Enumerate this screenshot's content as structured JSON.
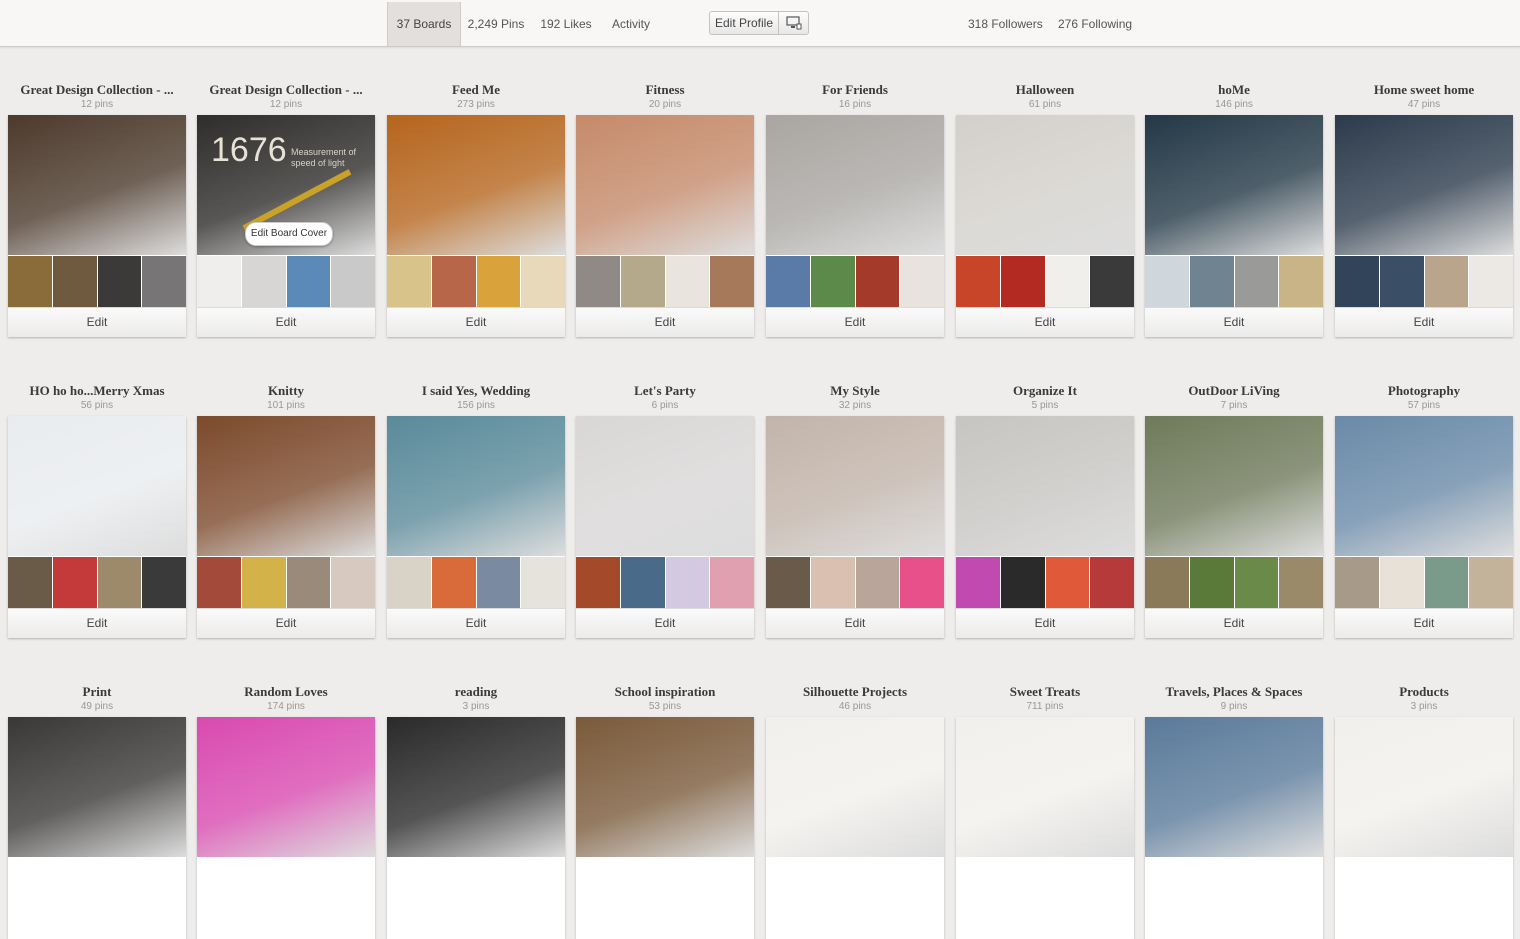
{
  "topbar": {
    "tabs": [
      "37 Boards",
      "2,249 Pins",
      "192 Likes",
      "Activity"
    ],
    "edit_profile": "Edit Profile",
    "followers": "318 Followers",
    "following": "276 Following"
  },
  "edit_label": "Edit",
  "edit_board_cover": "Edit Board Cover",
  "cover_number": "1676",
  "cover_caption": "Measurement of speed of light",
  "boards": [
    {
      "title": "Great Design Collection - ...",
      "count": "12 pins",
      "cover": "#4c3a2c",
      "thumbs": [
        "#8a6b3a",
        "#6f5a3f",
        "#3b3a38",
        "#777575"
      ]
    },
    {
      "title": "Great Design Collection - ...",
      "count": "12 pins",
      "cover": "#2f2d2b",
      "thumbs": [
        "#f0eeec",
        "#d8d6d4",
        "#5c8ab8",
        "#c9c9c9"
      ]
    },
    {
      "title": "Feed Me",
      "count": "273 pins",
      "cover": "#b5651d",
      "thumbs": [
        "#d8c38a",
        "#b7664a",
        "#d9a23a",
        "#e7d9b9"
      ]
    },
    {
      "title": "Fitness",
      "count": "20 pins",
      "cover": "#c58a6a",
      "thumbs": [
        "#8f8a86",
        "#b4a98a",
        "#e9e5de",
        "#a5795a"
      ]
    },
    {
      "title": "For Friends",
      "count": "16 pins",
      "cover": "#a9a6a2",
      "thumbs": [
        "#5a7aa8",
        "#5c8a4a",
        "#a43a2a",
        "#e8e3de"
      ]
    },
    {
      "title": "Halloween",
      "count": "61 pins",
      "cover": "#d3d0cb",
      "thumbs": [
        "#c9452a",
        "#b32a23",
        "#f1efec",
        "#3a3a3a"
      ]
    },
    {
      "title": "hoMe",
      "count": "146 pins",
      "cover": "#233846",
      "thumbs": [
        "#cfd6dc",
        "#6f8391",
        "#9a9b98",
        "#c9b488"
      ]
    },
    {
      "title": "Home sweet home",
      "count": "47 pins",
      "cover": "#2c3b4c",
      "thumbs": [
        "#31445a",
        "#3a4f66",
        "#b8a58c",
        "#ece8e3"
      ]
    },
    {
      "title": "HO ho ho...Merry Xmas",
      "count": "56 pins",
      "cover": "#e9ecef",
      "thumbs": [
        "#6a5a48",
        "#c43a3a",
        "#9c8a6a",
        "#3a3a3a"
      ]
    },
    {
      "title": "Knitty",
      "count": "101 pins",
      "cover": "#7c4a2c",
      "thumbs": [
        "#a34a3a",
        "#d4b24a",
        "#9a8a7a",
        "#d7c8c0"
      ]
    },
    {
      "title": "I said Yes, Wedding",
      "count": "156 pins",
      "cover": "#5a8a9a",
      "thumbs": [
        "#d9d2c6",
        "#d96a3a",
        "#7a8aa0",
        "#e6e2dc"
      ]
    },
    {
      "title": "Let's Party",
      "count": "6 pins",
      "cover": "#d9d6d6",
      "thumbs": [
        "#a44a2a",
        "#4a6a8a",
        "#d3c9e0",
        "#e0a0b0"
      ]
    },
    {
      "title": "My Style",
      "count": "32 pins",
      "cover": "#c2b4aa",
      "thumbs": [
        "#6a5a4a",
        "#d9c0b0",
        "#b9a59a",
        "#e8508a"
      ]
    },
    {
      "title": "Organize It",
      "count": "5 pins",
      "cover": "#c7c5c2",
      "thumbs": [
        "#c04ab0",
        "#2a2a2a",
        "#e05a3a",
        "#b73a3a"
      ]
    },
    {
      "title": "OutDoor LiVing",
      "count": "7 pins",
      "cover": "#6f7a5a",
      "thumbs": [
        "#8a7a5a",
        "#5a7a3a",
        "#6a8a4a",
        "#9a8a6a"
      ]
    },
    {
      "title": "Photography",
      "count": "57 pins",
      "cover": "#6a8aa8",
      "thumbs": [
        "#a89a88",
        "#e7e1d8",
        "#7a9a8a",
        "#c2b39a"
      ]
    },
    {
      "title": "Print",
      "count": "49 pins",
      "cover": "#3a3836",
      "thumbs": []
    },
    {
      "title": "Random Loves",
      "count": "174 pins",
      "cover": "#d94ab0",
      "thumbs": []
    },
    {
      "title": "reading",
      "count": "3 pins",
      "cover": "#2a2a2a",
      "thumbs": []
    },
    {
      "title": "School inspiration",
      "count": "53 pins",
      "cover": "#7a5a3a",
      "thumbs": []
    },
    {
      "title": "Silhouette Projects",
      "count": "46 pins",
      "cover": "#f2f0ec",
      "thumbs": []
    },
    {
      "title": "Sweet Treats",
      "count": "711 pins",
      "cover": "#f2f0ec",
      "thumbs": []
    },
    {
      "title": "Travels, Places & Spaces",
      "count": "9 pins",
      "cover": "#5a7a9a",
      "thumbs": []
    },
    {
      "title": "Products",
      "count": "3 pins",
      "cover": "#f2f0ec",
      "thumbs": []
    }
  ]
}
